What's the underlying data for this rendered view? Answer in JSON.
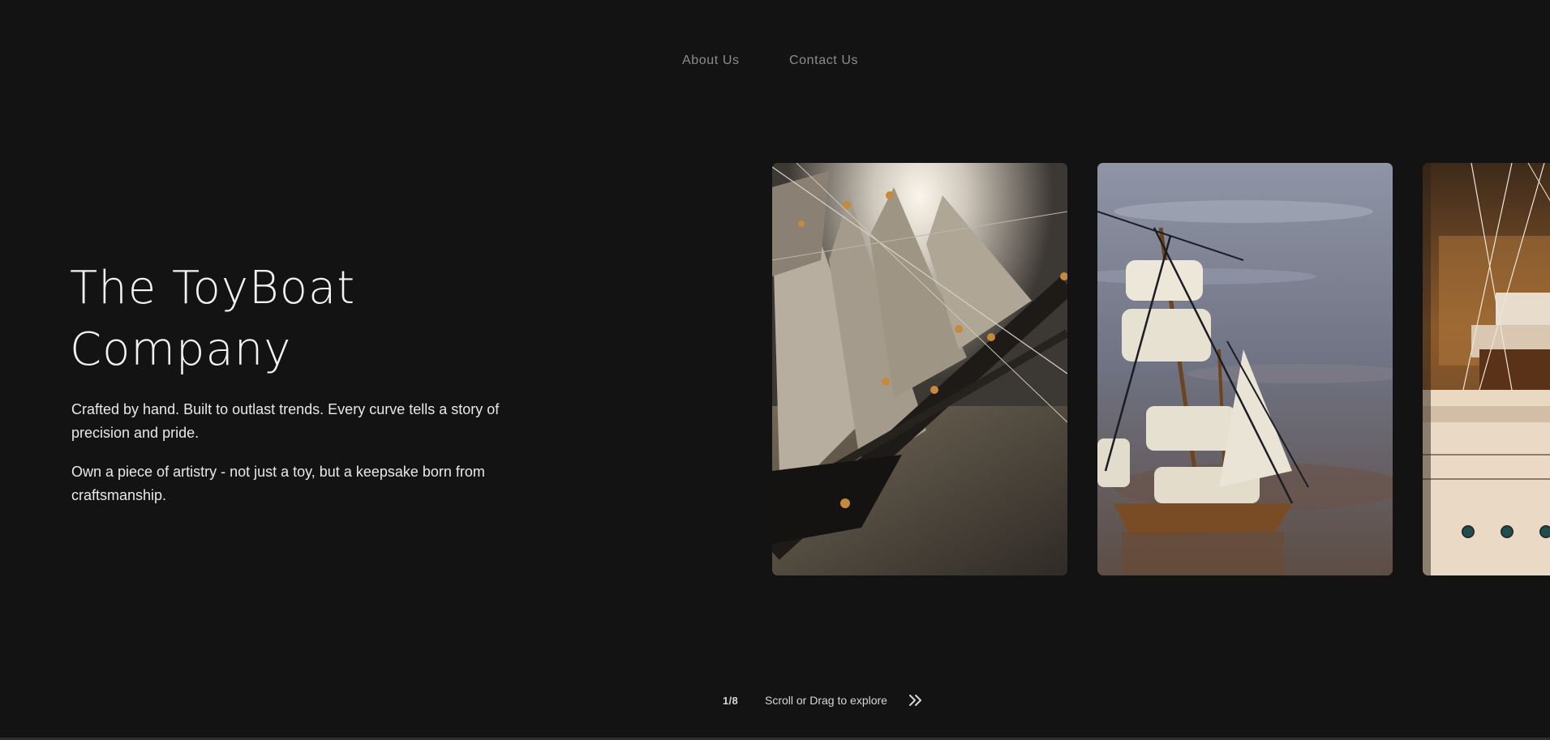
{
  "nav": {
    "items": [
      {
        "label": "About Us"
      },
      {
        "label": "Contact Us"
      }
    ]
  },
  "hero": {
    "title_line1": "The ToyBoat",
    "title_line2": "Company",
    "paragraph1": "Crafted by hand. Built to outlast trends. Every curve tells a story of precision and pride.",
    "paragraph2": "Own a piece of artistry - not just a toy, but a keepsake born from craftsmanship."
  },
  "gallery": {
    "cards": [
      {
        "subject": "model ship sails and rigging close-up"
      },
      {
        "subject": "model sailing ship on water"
      },
      {
        "subject": "model yacht with portholes"
      }
    ]
  },
  "explore": {
    "counter": "1/8",
    "hint": "Scroll or Drag to explore",
    "arrow_icon": "double-chevron-right-icon"
  },
  "colors": {
    "background": "#131313",
    "nav_text": "#8c8c8c",
    "body_text": "#e8e8e8"
  }
}
